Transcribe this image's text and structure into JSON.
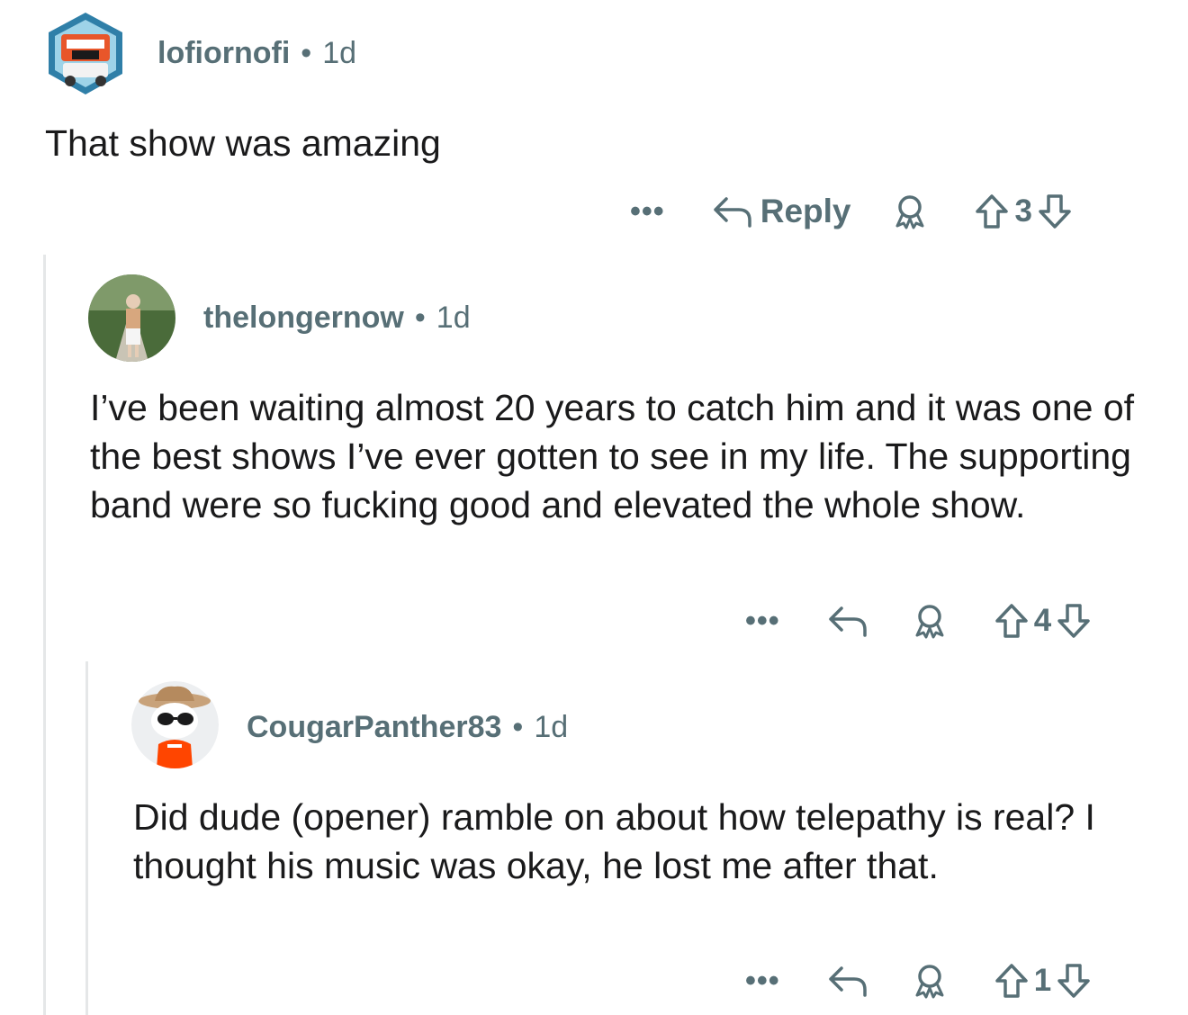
{
  "comments": [
    {
      "username": "lofiornofi",
      "separator": "•",
      "age": "1d",
      "body": "That show was amazing",
      "more": "•••",
      "reply_label": "Reply",
      "score": "3"
    },
    {
      "username": "thelongernow",
      "separator": "•",
      "age": "1d",
      "body": "I’ve been waiting almost 20 years to catch him and it was one of the best shows I’ve ever gotten to see in my life. The supporting band were so fucking good and elevated the whole show.",
      "more": "•••",
      "score": "4"
    },
    {
      "username": "CougarPanther83",
      "separator": "•",
      "age": "1d",
      "body": "Did dude (opener) ramble on about how telepathy is real? I thought his music was okay, he lost me after that.",
      "more": "•••",
      "score": "1"
    }
  ],
  "colors": {
    "meta_text": "#576f76",
    "body_text": "#1a1a1b",
    "thread_line": "#e5e7e8"
  },
  "icons": [
    "reply-arrow-icon",
    "award-icon",
    "upvote-icon",
    "downvote-icon",
    "more-options-icon"
  ]
}
